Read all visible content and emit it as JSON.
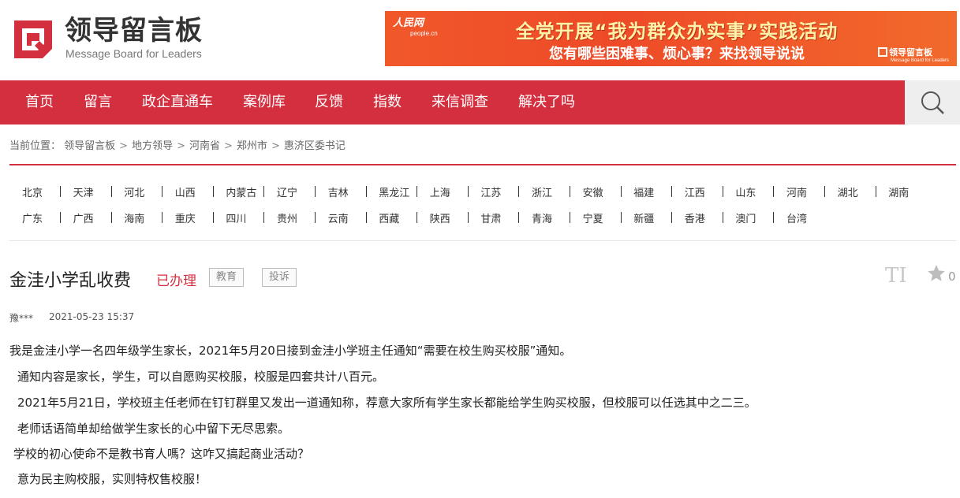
{
  "header": {
    "logo_cn": "领导留言板",
    "logo_en": "Message Board for Leaders",
    "banner": {
      "people_name": "人民网",
      "people_url": "people.cn",
      "line1": "全党开展“我为群众办实事”实践活动",
      "line2": "您有哪些困难事、烦心事？来找领导说说",
      "mini_logo": "领导留言板",
      "mini_logo_en": "Message Board for Leaders"
    }
  },
  "nav": {
    "items": [
      "首页",
      "留言",
      "政企直通车",
      "案例库",
      "反馈",
      "指数",
      "来信调查",
      "解决了吗"
    ]
  },
  "breadcrumb": {
    "label": "当前位置：",
    "items": [
      "领导留言板",
      "地方领导",
      "河南省",
      "郑州市",
      "惠济区委书记"
    ],
    "separator": ">"
  },
  "provinces": {
    "row1": [
      "北京",
      "天津",
      "河北",
      "山西",
      "内蒙古",
      "辽宁",
      "吉林",
      "黑龙江",
      "上海",
      "江苏",
      "浙江",
      "安徽",
      "福建",
      "江西",
      "山东",
      "河南",
      "湖北",
      "湖南"
    ],
    "row2": [
      "广东",
      "广西",
      "海南",
      "重庆",
      "四川",
      "贵州",
      "云南",
      "西藏",
      "陕西",
      "甘肃",
      "青海",
      "宁夏",
      "新疆",
      "香港",
      "澳门",
      "台湾"
    ]
  },
  "message": {
    "title": "金洼小学乱收费",
    "status": "已办理",
    "tags": [
      "教育",
      "投诉"
    ],
    "font_tool": "TI",
    "favorites": "0",
    "user": "豫***",
    "time": "2021-05-23 15:37",
    "paragraphs": [
      "我是金洼小学一名四年级学生家长，2021年5月20日接到金洼小学班主任通知“需要在校生购买校服”通知。",
      "通知内容是家长，学生，可以自愿购买校服，校服是四套共计八百元。",
      "2021年5月21日，学校班主任老师在钉钉群里又发出一道通知称，荐意大家所有学生家长都能给学生购买校服，但校服可以任选其中之二三。",
      "老师话语简单却给做学生家长的心中留下无尽思索。",
      "学校的初心使命不是教书育人嗎？这咋又搞起商业活动？",
      "意为民主购校服，实则特权售校服！"
    ]
  },
  "colors": {
    "brand_red": "#d42f3f",
    "banner_orange": "#ee4a28"
  }
}
